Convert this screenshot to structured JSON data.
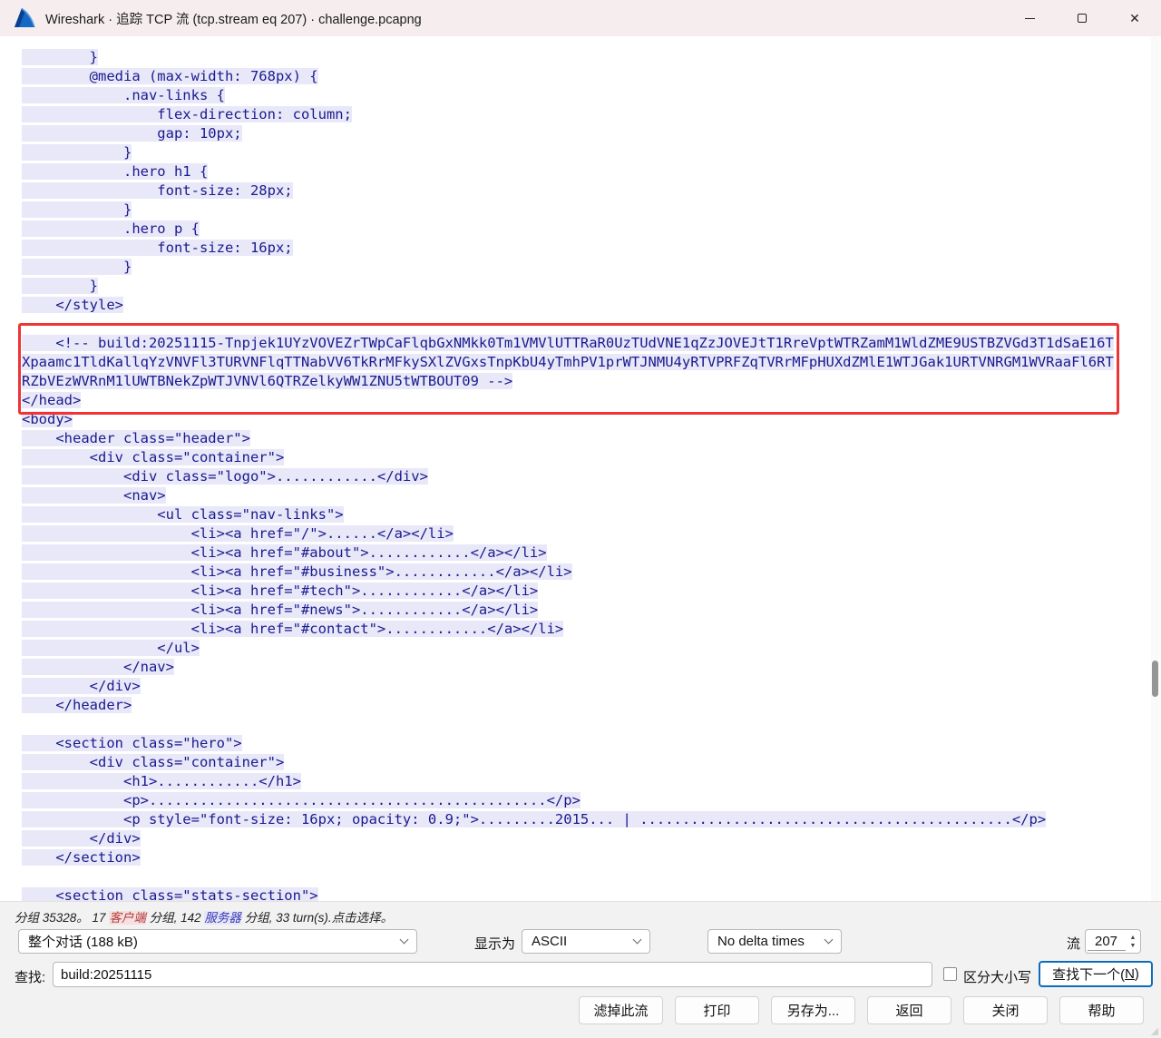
{
  "window": {
    "title": "Wireshark · 追踪 TCP 流 (tcp.stream eq 207) · challenge.pcapng"
  },
  "stream": {
    "lines": [
      "        }",
      "        @media (max-width: 768px) {",
      "            .nav-links {",
      "                flex-direction: column;",
      "                gap: 10px;",
      "            }",
      "            .hero h1 {",
      "                font-size: 28px;",
      "            }",
      "            .hero p {",
      "                font-size: 16px;",
      "            }",
      "        }",
      "    </style>",
      "",
      "    <!-- build:20251115-Tnpjek1UYzVOVEZrTWpCaFlqbGxNMkk0Tm1VMVlUTTRaR0UzTUdVNE1qZzJOVEJtT1RreVptWTRZamM1WldZME9USTBZVGd3T1dSaE16T",
      "Xpaamc1TldKallqYzVNVFl3TURVNFlqTTNabVV6TkRrMFkySXlZVGxsTnpKbU4yTmhPV1prWTJNMU4yRTVPRFZqTVRrMFpHUXdZMlE1WTJGak1URTVNRGM1WVRaaFl6RT",
      "RZbVEzWVRnM1lUWTBNekZpWTJVNVl6QTRZelkyWW1ZNU5tWTBOUT09 -->",
      "</head>",
      "<body>",
      "    <header class=\"header\">",
      "        <div class=\"container\">",
      "            <div class=\"logo\">............</div>",
      "            <nav>",
      "                <ul class=\"nav-links\">",
      "                    <li><a href=\"/\">......</a></li>",
      "                    <li><a href=\"#about\">............</a></li>",
      "                    <li><a href=\"#business\">............</a></li>",
      "                    <li><a href=\"#tech\">............</a></li>",
      "                    <li><a href=\"#news\">............</a></li>",
      "                    <li><a href=\"#contact\">............</a></li>",
      "                </ul>",
      "            </nav>",
      "        </div>",
      "    </header>",
      "",
      "    <section class=\"hero\">",
      "        <div class=\"container\">",
      "            <h1>............</h1>",
      "            <p>...............................................</p>",
      "            <p style=\"font-size: 16px; opacity: 0.9;\">.........2015... | ............................................</p>",
      "        </div>",
      "    </section>",
      "",
      "    <section class=\"stats-section\">"
    ],
    "annotation_color": "#ee3434",
    "server_text_color": "#1a1a8f",
    "server_bg_color": "#e8e8f8"
  },
  "footer": {
    "hint_segments": [
      {
        "text": "分组 35328。 "
      },
      {
        "text": "17 "
      },
      {
        "text": "客户端",
        "style": "client"
      },
      {
        "text": " 分组, "
      },
      {
        "text": "142 "
      },
      {
        "text": "服务器",
        "style": "server"
      },
      {
        "text": " 分组, "
      },
      {
        "text": "33 turn(s).点击选择。"
      }
    ],
    "range_combo_value": "整个对话 (188 kB)",
    "show_as_label": "显示为",
    "show_as_combo_value": "ASCII",
    "delta_combo_value": "No delta times",
    "stream_label": "流",
    "stream_number": "207",
    "find_label": "查找:",
    "find_value": "build:20251115",
    "case_sensitive_label": "区分大小写",
    "find_next_prefix": "查找下一个(",
    "find_next_key": "N",
    "find_next_suffix": ")",
    "buttons": [
      {
        "name": "filter-out-stream-button",
        "label": "滤掉此流"
      },
      {
        "name": "print-button",
        "label": "打印"
      },
      {
        "name": "save-as-button",
        "label": "另存为..."
      },
      {
        "name": "back-button",
        "label": "返回"
      },
      {
        "name": "close-stream-button",
        "label": "关闭"
      },
      {
        "name": "help-button",
        "label": "帮助"
      }
    ]
  }
}
